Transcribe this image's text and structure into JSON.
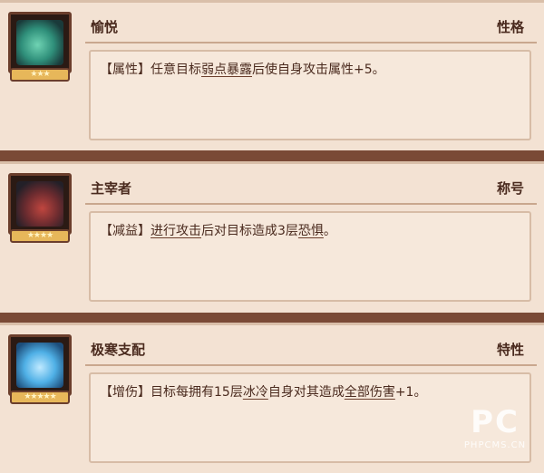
{
  "cards": [
    {
      "name": "愉悦",
      "tag": "性格",
      "stars": "★★★",
      "desc": {
        "prefix": "【属性】任意目标",
        "kw1": "弱点暴露",
        "mid": "后使自身攻击属性+5。",
        "kw2": "",
        "suffix": ""
      }
    },
    {
      "name": "主宰者",
      "tag": "称号",
      "stars": "★★★★",
      "desc": {
        "prefix": "【减益】",
        "kw1": "进行攻击",
        "mid": "后对目标造成3层",
        "kw2": "恐惧",
        "suffix": "。"
      }
    },
    {
      "name": "极寒支配",
      "tag": "特性",
      "stars": "★★★★★",
      "desc": {
        "prefix": "【增伤】目标每拥有15层",
        "kw1": "冰冷",
        "mid": "自身对其造成",
        "kw2": "全部伤害",
        "suffix": "+1。"
      }
    }
  ],
  "watermark": {
    "logo": "PC",
    "site": "PHPCMS.CN"
  },
  "icons": [
    "character-portrait-icon",
    "star-rating-icon"
  ]
}
